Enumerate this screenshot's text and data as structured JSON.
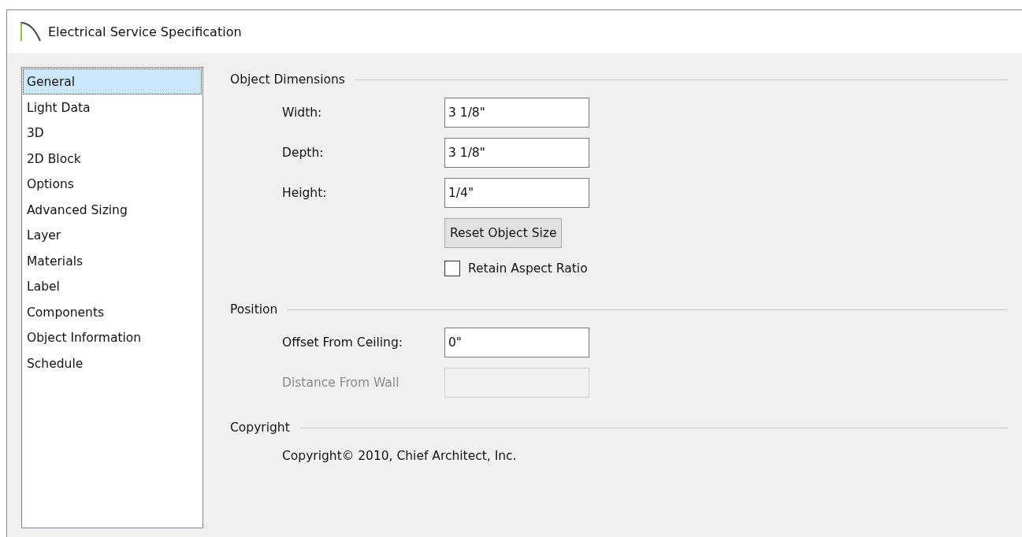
{
  "window": {
    "title": "Electrical Service Specification"
  },
  "sidebar": {
    "items": [
      {
        "label": "General",
        "selected": true
      },
      {
        "label": "Light Data",
        "selected": false
      },
      {
        "label": "3D",
        "selected": false
      },
      {
        "label": "2D Block",
        "selected": false
      },
      {
        "label": "Options",
        "selected": false
      },
      {
        "label": "Advanced Sizing",
        "selected": false
      },
      {
        "label": "Layer",
        "selected": false
      },
      {
        "label": "Materials",
        "selected": false
      },
      {
        "label": "Label",
        "selected": false
      },
      {
        "label": "Components",
        "selected": false
      },
      {
        "label": "Object Information",
        "selected": false
      },
      {
        "label": "Schedule",
        "selected": false
      }
    ]
  },
  "sections": [
    {
      "title": "Object Dimensions",
      "rows": [
        {
          "kind": "field",
          "label": "Width:",
          "value": "3 1/8\"",
          "disabled": false
        },
        {
          "kind": "field",
          "label": "Depth:",
          "value": "3 1/8\"",
          "disabled": false
        },
        {
          "kind": "field",
          "label": "Height:",
          "value": "1/4\"",
          "disabled": false
        },
        {
          "kind": "button",
          "label": "Reset Object Size"
        },
        {
          "kind": "checkbox",
          "label": "Retain Aspect Ratio",
          "checked": false
        }
      ]
    },
    {
      "title": "Position",
      "rows": [
        {
          "kind": "field",
          "label": "Offset From Ceiling:",
          "value": "0\"",
          "disabled": false
        },
        {
          "kind": "field",
          "label": "Distance From Wall",
          "disabled": true
        }
      ]
    },
    {
      "title": "Copyright",
      "rows": [
        {
          "kind": "text",
          "label": "Copyright© 2010, Chief Architect, Inc."
        }
      ]
    }
  ]
}
